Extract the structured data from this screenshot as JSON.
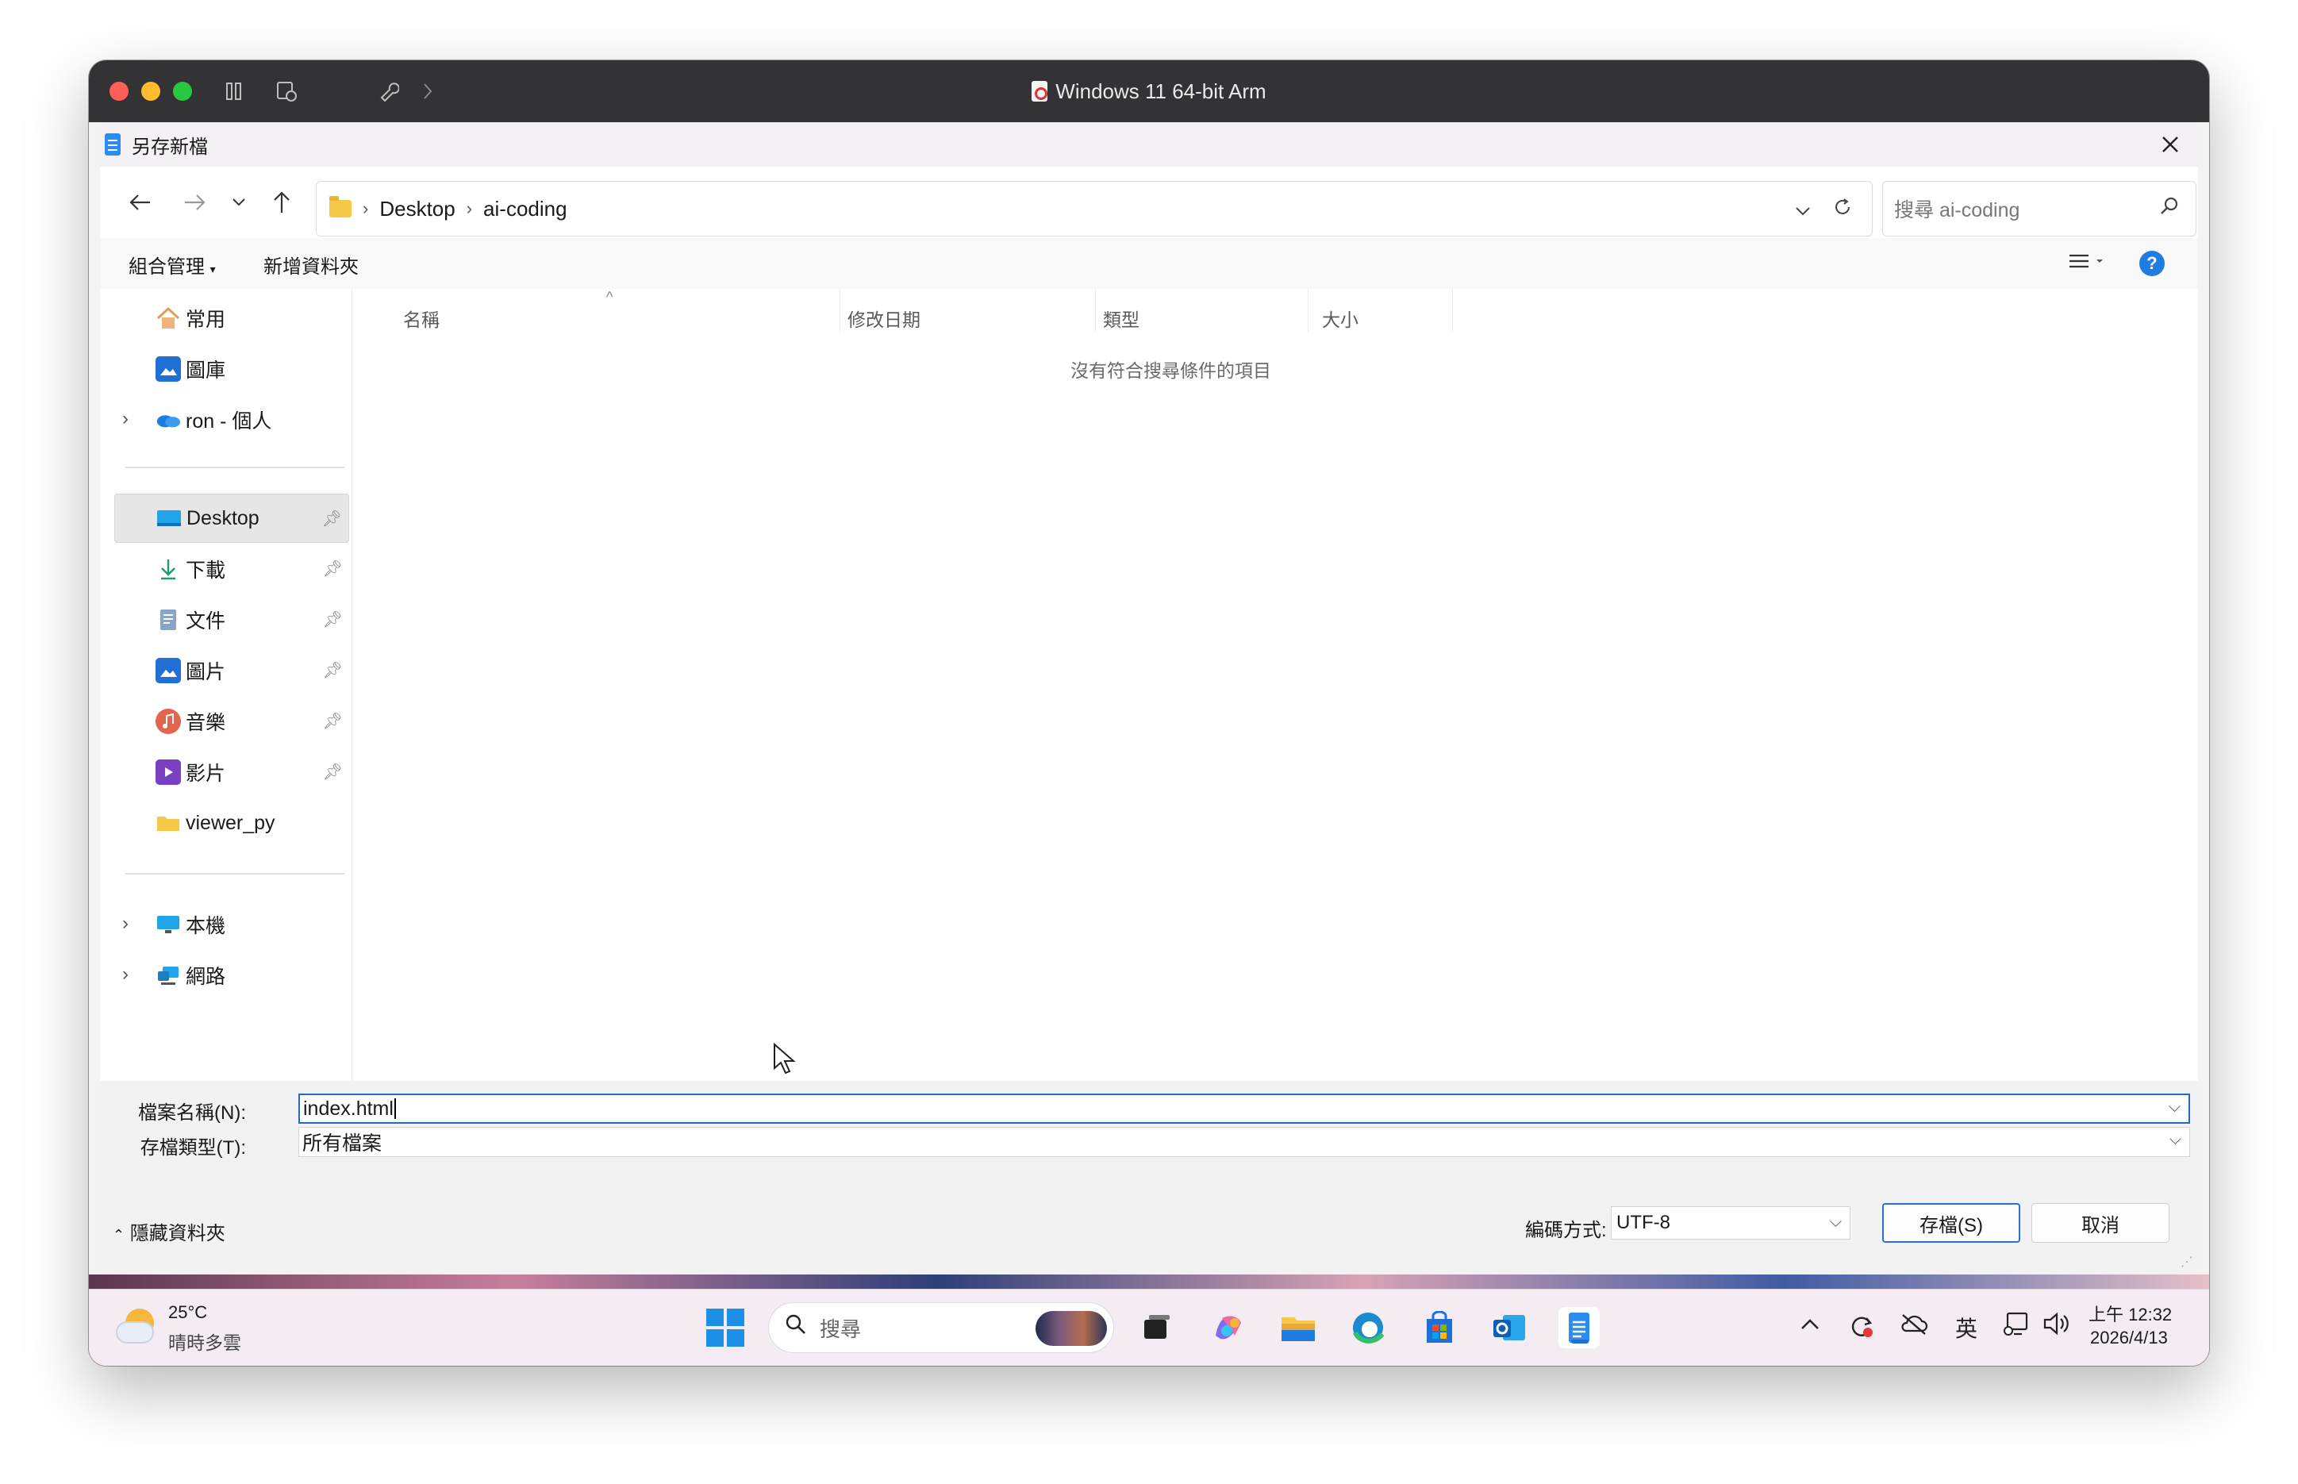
{
  "mac": {
    "window_title": "Windows 11 64-bit Arm"
  },
  "dialog": {
    "title": "另存新檔",
    "address": {
      "crumbs": [
        "Desktop",
        "ai-coding"
      ]
    },
    "search_placeholder": "搜尋 ai-coding",
    "command_bar": {
      "organize": "組合管理",
      "new_folder": "新增資料夾"
    },
    "nav": {
      "quick": [
        {
          "label": "常用",
          "icon": "home-icon"
        },
        {
          "label": "圖庫",
          "icon": "gallery-icon"
        },
        {
          "label": "ron - 個人",
          "icon": "onedrive-icon"
        }
      ],
      "pinned": [
        {
          "label": "Desktop",
          "icon": "desktop-icon"
        },
        {
          "label": "下載",
          "icon": "download-icon"
        },
        {
          "label": "文件",
          "icon": "documents-icon"
        },
        {
          "label": "圖片",
          "icon": "pictures-icon"
        },
        {
          "label": "音樂",
          "icon": "music-icon"
        },
        {
          "label": "影片",
          "icon": "videos-icon"
        },
        {
          "label": "viewer_py",
          "icon": "folder-icon"
        }
      ],
      "devices": [
        {
          "label": "本機",
          "icon": "computer-icon"
        },
        {
          "label": "網路",
          "icon": "network-icon"
        }
      ]
    },
    "columns": [
      "名稱",
      "修改日期",
      "類型",
      "大小"
    ],
    "empty_message": "沒有符合搜尋條件的項目",
    "filename_label": "檔案名稱(N):",
    "filename_value": "index.html",
    "filetype_label": "存檔類型(T):",
    "filetype_value": "所有檔案",
    "hide_folders": "隱藏資料夾",
    "encoding_label": "編碼方式:",
    "encoding_value": "UTF-8",
    "save_button": "存檔(S)",
    "cancel_button": "取消"
  },
  "taskbar": {
    "weather_temp": "25°C",
    "weather_desc": "晴時多雲",
    "search_placeholder": "搜尋",
    "ime": "英",
    "time": "上午 12:32",
    "date": "2026/4/13"
  },
  "colors": {
    "accent": "#2767c7",
    "mac_titlebar": "#333335",
    "taskbar": "#f5ebf2"
  }
}
